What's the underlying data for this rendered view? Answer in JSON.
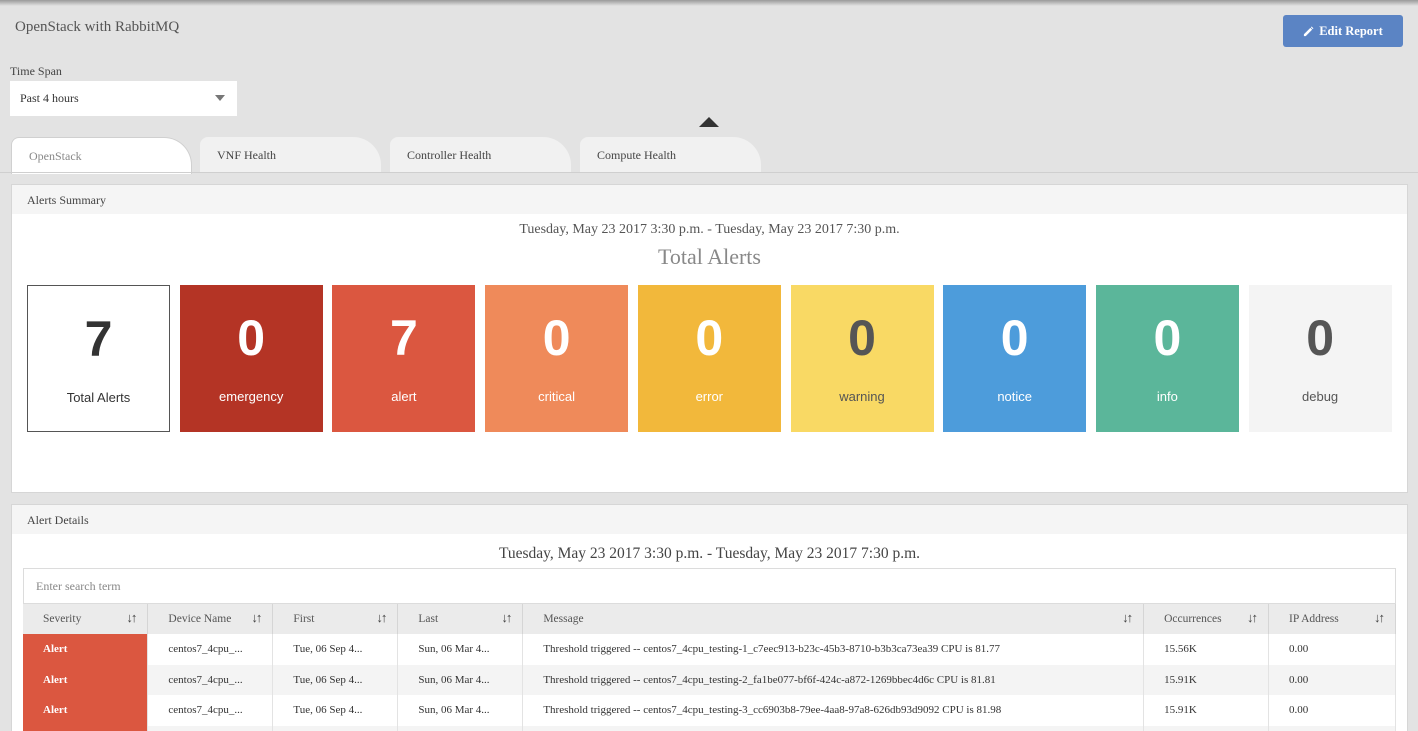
{
  "header": {
    "title": "OpenStack with RabbitMQ",
    "edit_label": "Edit Report"
  },
  "timespan": {
    "label": "Time Span",
    "value": "Past 4 hours"
  },
  "tabs": [
    {
      "label": "OpenStack",
      "active": true
    },
    {
      "label": "VNF Health",
      "active": false
    },
    {
      "label": "Controller Health",
      "active": false
    },
    {
      "label": "Compute Health",
      "active": false
    }
  ],
  "summary": {
    "title": "Alerts Summary",
    "daterange": "Tuesday, May 23 2017 3:30 p.m. - Tuesday, May 23 2017 7:30 p.m.",
    "heading": "Total Alerts",
    "tiles": [
      {
        "value": "7",
        "label": "Total Alerts",
        "bg": "#ffffff",
        "fg": "#333333"
      },
      {
        "value": "0",
        "label": "emergency",
        "bg": "#b43425",
        "fg": "#ffffff"
      },
      {
        "value": "7",
        "label": "alert",
        "bg": "#db5740",
        "fg": "#ffffff"
      },
      {
        "value": "0",
        "label": "critical",
        "bg": "#ef8a5a",
        "fg": "#ffffff"
      },
      {
        "value": "0",
        "label": "error",
        "bg": "#f2b83b",
        "fg": "#ffffff"
      },
      {
        "value": "0",
        "label": "warning",
        "bg": "#f9d964",
        "fg": "#555555"
      },
      {
        "value": "0",
        "label": "notice",
        "bg": "#4d9cdb",
        "fg": "#ffffff"
      },
      {
        "value": "0",
        "label": "info",
        "bg": "#5bb69a",
        "fg": "#ffffff"
      },
      {
        "value": "0",
        "label": "debug",
        "bg": "#f4f4f4",
        "fg": "#555555"
      }
    ]
  },
  "details": {
    "title": "Alert Details",
    "daterange": "Tuesday, May 23 2017 3:30 p.m. - Tuesday, May 23 2017 7:30 p.m.",
    "search_placeholder": "Enter search term",
    "columns": [
      "Severity",
      "Device Name",
      "First",
      "Last",
      "Message",
      "Occurrences",
      "IP Address"
    ],
    "rows": [
      [
        "Alert",
        "centos7_4cpu_...",
        "Tue, 06 Sep 4...",
        "Sun, 06 Mar 4...",
        "Threshold triggered -- centos7_4cpu_testing-1_c7eec913-b23c-45b3-8710-b3b3ca73ea39 CPU is 81.77",
        "15.56K",
        "0.00"
      ],
      [
        "Alert",
        "centos7_4cpu_...",
        "Tue, 06 Sep 4...",
        "Sun, 06 Mar 4...",
        "Threshold triggered -- centos7_4cpu_testing-2_fa1be077-bf6f-424c-a872-1269bbec4d6c CPU is 81.81",
        "15.91K",
        "0.00"
      ],
      [
        "Alert",
        "centos7_4cpu_...",
        "Tue, 06 Sep 4...",
        "Sun, 06 Mar 4...",
        "Threshold triggered -- centos7_4cpu_testing-3_cc6903b8-79ee-4aa8-97a8-626db93d9092 CPU is 81.98",
        "15.91K",
        "0.00"
      ],
      [
        "",
        "",
        "",
        "",
        "",
        "",
        ""
      ]
    ]
  }
}
